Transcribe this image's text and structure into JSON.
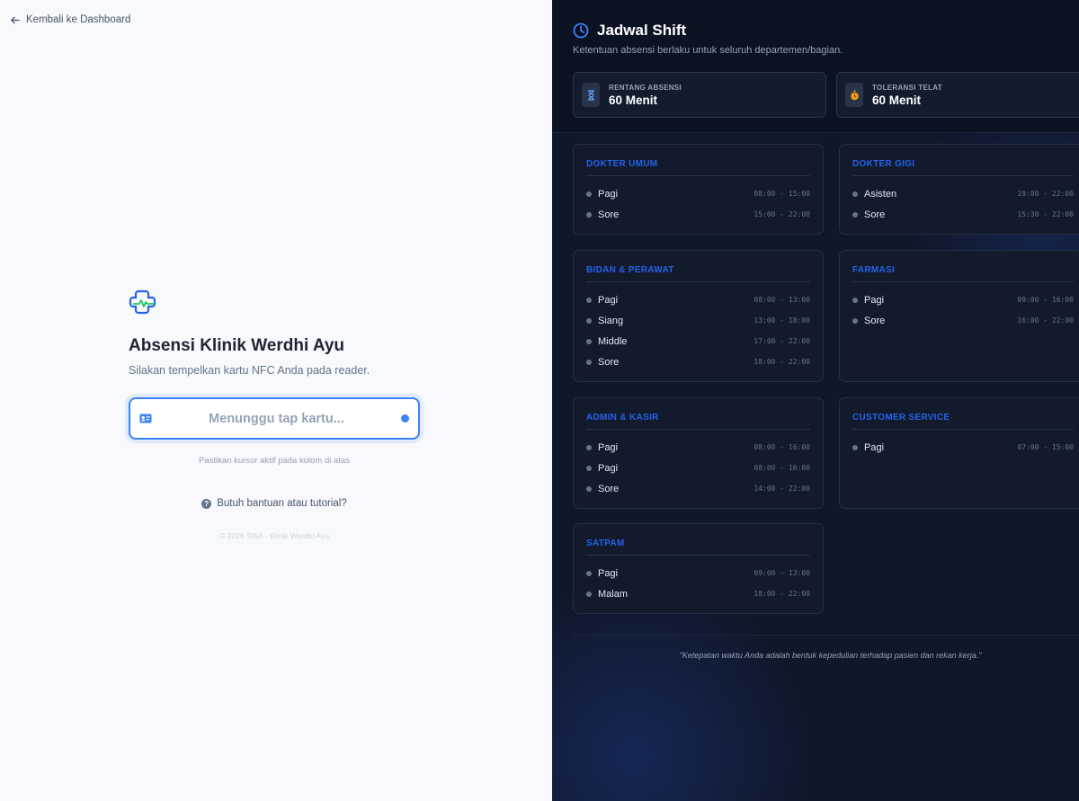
{
  "left": {
    "back_label": "Kembali ke Dashboard",
    "title": "Absensi Klinik Werdhi Ayu",
    "subtitle": "Silakan tempelkan kartu NFC Anda pada reader.",
    "input_placeholder": "Menunggu tap kartu...",
    "hint": "Pastikan kursor aktif pada kolom di atas",
    "help_label": "Butuh bantuan atau tutorial?",
    "copyright": "© 2026 SWA - Klinik Werdhi Ayu"
  },
  "right": {
    "title": "Jadwal Shift",
    "subtitle": "Ketentuan absensi berlaku untuk seluruh departemen/bagian.",
    "stats": [
      {
        "label": "RENTANG ABSENSI",
        "value": "60 Menit",
        "icon": "hourglass-icon"
      },
      {
        "label": "TOLERANSI TELAT",
        "value": "60 Menit",
        "icon": "stopwatch-icon"
      }
    ],
    "departments": [
      {
        "name": "DOKTER UMUM",
        "shifts": [
          {
            "name": "Pagi",
            "time": "08:00 - 15:00"
          },
          {
            "name": "Sore",
            "time": "15:00 - 22:00"
          }
        ]
      },
      {
        "name": "DOKTER GIGI",
        "shifts": [
          {
            "name": "Asisten",
            "time": "19:00 - 22:00"
          },
          {
            "name": "Sore",
            "time": "15:30 - 22:00"
          }
        ]
      },
      {
        "name": "BIDAN & PERAWAT",
        "shifts": [
          {
            "name": "Pagi",
            "time": "08:00 - 13:00"
          },
          {
            "name": "Siang",
            "time": "13:00 - 18:00"
          },
          {
            "name": "Middle",
            "time": "17:00 - 22:00"
          },
          {
            "name": "Sore",
            "time": "18:00 - 22:00"
          }
        ]
      },
      {
        "name": "FARMASI",
        "shifts": [
          {
            "name": "Pagi",
            "time": "09:00 - 16:00"
          },
          {
            "name": "Sore",
            "time": "16:00 - 22:00"
          }
        ]
      },
      {
        "name": "ADMIN & KASIR",
        "shifts": [
          {
            "name": "Pagi",
            "time": "08:00 - 16:00"
          },
          {
            "name": "Pagi",
            "time": "08:00 - 16:00"
          },
          {
            "name": "Sore",
            "time": "14:00 - 22:00"
          }
        ]
      },
      {
        "name": "CUSTOMER SERVICE",
        "shifts": [
          {
            "name": "Pagi",
            "time": "07:00 - 15:00"
          }
        ]
      },
      {
        "name": "SATPAM",
        "shifts": [
          {
            "name": "Pagi",
            "time": "09:00 - 13:00"
          },
          {
            "name": "Malam",
            "time": "18:00 - 22:00"
          }
        ]
      }
    ],
    "quote": "\"Ketepatan waktu Anda adalah bentuk kepedulian terhadap pasien dan rekan kerja.\""
  },
  "colors": {
    "accent": "#3b82f6",
    "dept_title": "#2563eb",
    "panel_dark": "#0f172a"
  }
}
